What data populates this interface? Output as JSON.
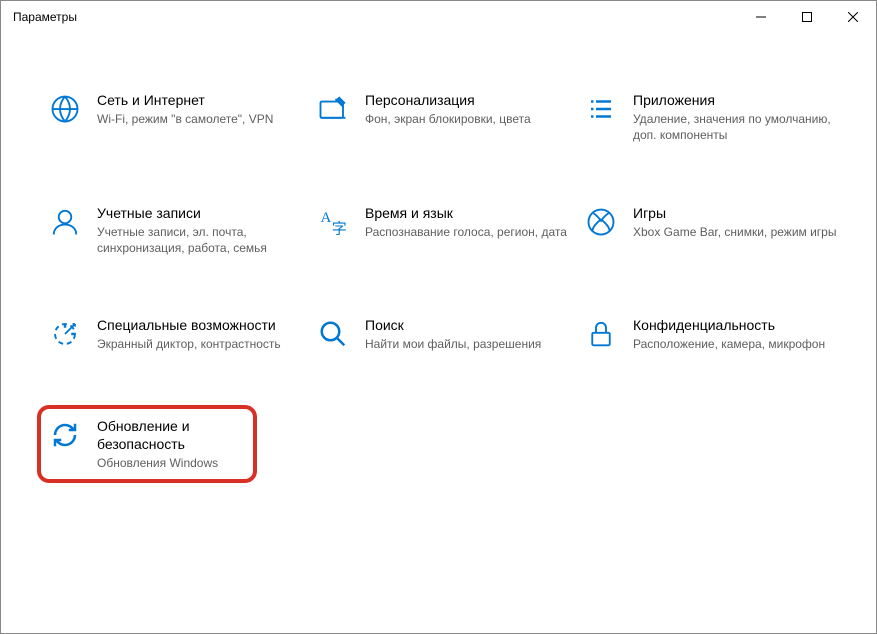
{
  "window": {
    "title": "Параметры"
  },
  "tiles": {
    "network": {
      "title": "Сеть и Интернет",
      "desc": "Wi-Fi, режим \"в самолете\", VPN"
    },
    "personalization": {
      "title": "Персонализация",
      "desc": "Фон, экран блокировки, цвета"
    },
    "apps": {
      "title": "Приложения",
      "desc": "Удаление, значения по умолчанию, доп. компоненты"
    },
    "accounts": {
      "title": "Учетные записи",
      "desc": "Учетные записи, эл. почта, синхронизация, работа, семья"
    },
    "time_language": {
      "title": "Время и язык",
      "desc": "Распознавание голоса, регион, дата"
    },
    "gaming": {
      "title": "Игры",
      "desc": "Xbox Game Bar, снимки, режим игры"
    },
    "ease_of_access": {
      "title": "Специальные возможности",
      "desc": "Экранный диктор, контрастность"
    },
    "search": {
      "title": "Поиск",
      "desc": "Найти мои файлы, разрешения"
    },
    "privacy": {
      "title": "Конфиденциальность",
      "desc": "Расположение, камера, микрофон"
    },
    "update_security": {
      "title": "Обновление и безопасность",
      "desc": "Обновления Windows"
    }
  }
}
